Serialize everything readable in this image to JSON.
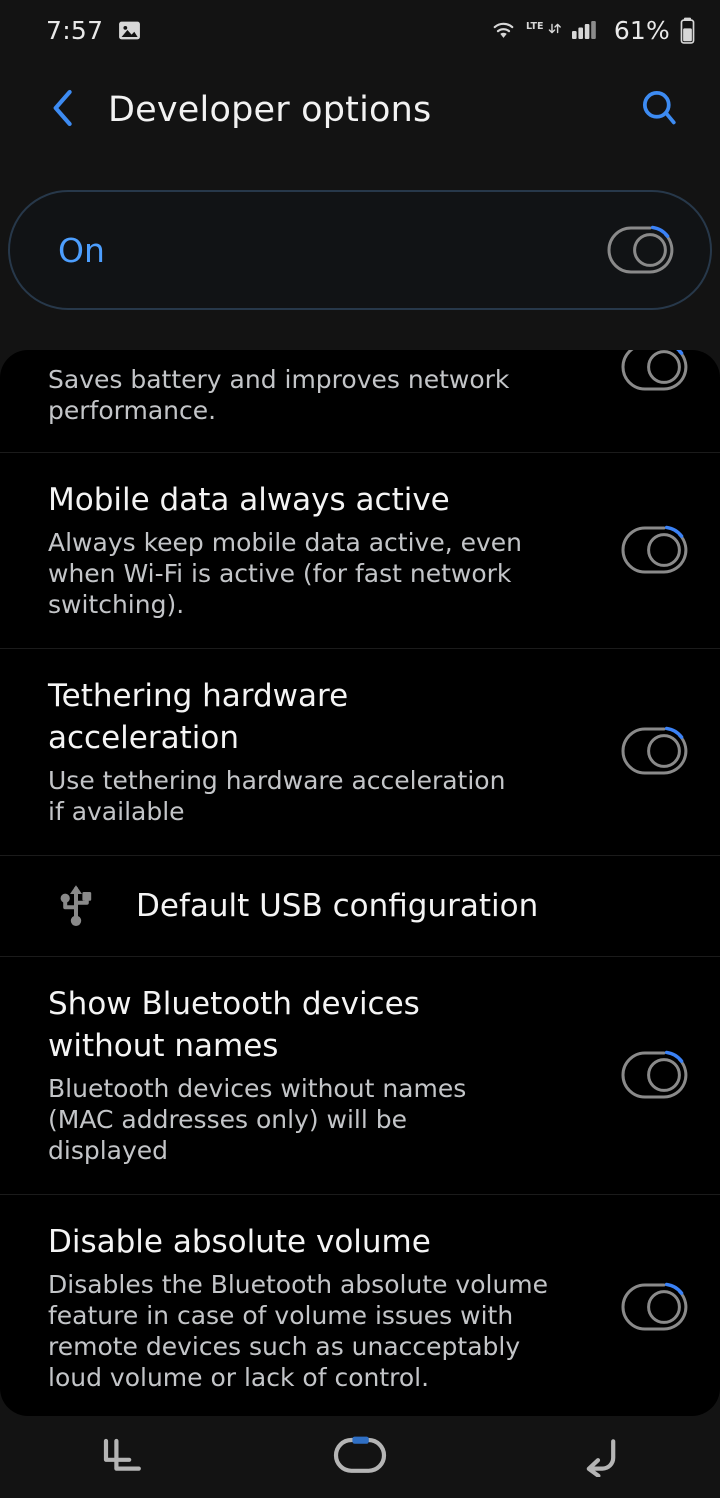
{
  "status_bar": {
    "time": "7:57",
    "icons": [
      "image-icon",
      "wifi-icon",
      "lte-icon",
      "signal-icon"
    ],
    "network_type": "LTE",
    "battery_percent": "61%"
  },
  "header": {
    "title": "Developer options",
    "back_icon": "back-chevron-icon",
    "search_icon": "search-icon"
  },
  "master_switch": {
    "label": "On",
    "state": "on"
  },
  "colors": {
    "accent_blue": "#4d9fff",
    "toggle_blue": "#3b82f6",
    "page_background": "#131313",
    "card_background": "#000000",
    "master_card_border": "#27384a",
    "title_text": "#f4f4f4",
    "description_text": "#c3c5c8",
    "icon_gray": "#8a8a8a"
  },
  "list": {
    "items": [
      {
        "title": "",
        "description": "Saves battery and improves network performance.",
        "control": "switch",
        "state": "on",
        "clipped": true
      },
      {
        "title": "Mobile data always active",
        "description": "Always keep mobile data active, even when Wi-Fi is active (for fast network switching).",
        "control": "switch",
        "state": "on"
      },
      {
        "title": "Tethering hardware acceleration",
        "description": "Use tethering hardware acceleration if available",
        "control": "switch",
        "state": "on"
      },
      {
        "title": "Default USB configuration",
        "description": "",
        "control": "none",
        "icon": "usb-icon"
      },
      {
        "title": "Show Bluetooth devices without names",
        "description": "Bluetooth devices without names (MAC addresses only) will be displayed",
        "control": "switch",
        "state": "on"
      },
      {
        "title": "Disable absolute volume",
        "description": "Disables the Bluetooth absolute volume feature in case of volume issues with remote devices such as unacceptably loud volume or lack of control.",
        "control": "switch",
        "state": "on"
      }
    ]
  },
  "nav_bar": {
    "recents_icon": "recents-icon",
    "home_icon": "home-icon",
    "back_icon": "back-icon"
  }
}
